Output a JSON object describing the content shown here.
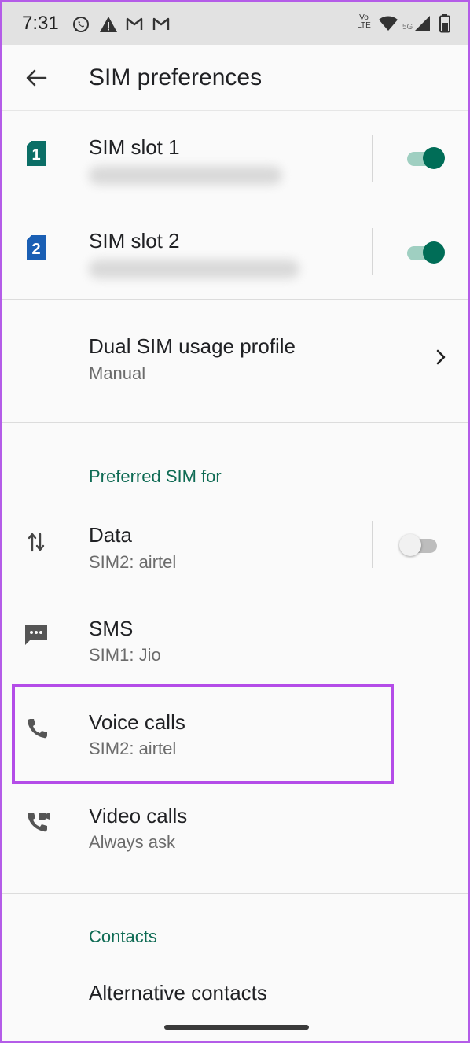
{
  "status_bar": {
    "time": "7:31",
    "network_text": "Vo LTE",
    "network_gen": "5G"
  },
  "app_bar": {
    "title": "SIM preferences"
  },
  "sim_slots": [
    {
      "label": "SIM slot 1",
      "badge": "1",
      "enabled": true
    },
    {
      "label": "SIM slot 2",
      "badge": "2",
      "enabled": true
    }
  ],
  "dual_sim_profile": {
    "title": "Dual SIM usage profile",
    "value": "Manual"
  },
  "preferred_section": {
    "header": "Preferred SIM for",
    "items": [
      {
        "title": "Data",
        "value": "SIM2: airtel",
        "toggle_enabled": false
      },
      {
        "title": "SMS",
        "value": "SIM1: Jio"
      },
      {
        "title": "Voice calls",
        "value": "SIM2: airtel"
      },
      {
        "title": "Video calls",
        "value": "Always ask"
      }
    ]
  },
  "contacts_section": {
    "header": "Contacts",
    "items": [
      {
        "title": "Alternative contacts"
      }
    ]
  },
  "colors": {
    "accent": "#006d57",
    "section_header": "#0f6b54",
    "highlight": "#b44ce8",
    "sim1_badge": "#0b6e66",
    "sim2_badge": "#1a5fb4"
  }
}
